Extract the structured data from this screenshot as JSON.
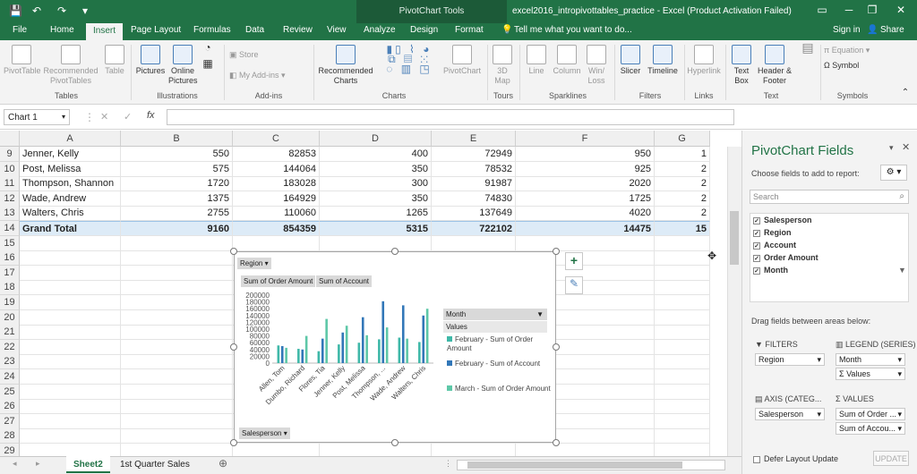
{
  "window": {
    "context_label": "PivotChart Tools",
    "title": "excel2016_intropivottables_practice - Excel (Product Activation Failed)",
    "minimize": "─",
    "restore": "❐",
    "close": "✕"
  },
  "tabs": [
    "File",
    "Home",
    "Insert",
    "Page Layout",
    "Formulas",
    "Data",
    "Review",
    "View",
    "Analyze",
    "Design",
    "Format"
  ],
  "tell_me": "Tell me what you want to do...",
  "sign_in": "Sign in",
  "share": "Share",
  "ribbon": {
    "buttons": {
      "pivottable": "PivotTable",
      "recommended_pivottables": "Recommended PivotTables",
      "table": "Table",
      "pictures": "Pictures",
      "online_pictures": "Online Pictures",
      "store": "Store",
      "my_addins": "My Add-ins",
      "recommended_charts": "Recommended Charts",
      "pivotchart": "PivotChart",
      "map3d": "3D Map",
      "line": "Line",
      "column": "Column",
      "winloss": "Win/ Loss",
      "slicer": "Slicer",
      "timeline": "Timeline",
      "hyperlink": "Hyperlink",
      "textbox": "Text Box",
      "header_footer": "Header & Footer",
      "equation": "Equation",
      "symbol": "Symbol"
    },
    "groups": {
      "tables": "Tables",
      "illustrations": "Illustrations",
      "addins": "Add-ins",
      "charts": "Charts",
      "tours": "Tours",
      "sparklines": "Sparklines",
      "filters": "Filters",
      "links": "Links",
      "text": "Text",
      "symbols": "Symbols"
    }
  },
  "formula_bar": {
    "name_box": "Chart 1",
    "fx": "fx",
    "cancel": "✕",
    "enter": "✓"
  },
  "sheet": {
    "columns": [
      "A",
      "B",
      "C",
      "D",
      "E",
      "F",
      "G"
    ],
    "rows": [
      {
        "num": "9",
        "cells": [
          "Jenner, Kelly",
          "550",
          "82853",
          "400",
          "72949",
          "950",
          "1"
        ]
      },
      {
        "num": "10",
        "cells": [
          "Post, Melissa",
          "575",
          "144064",
          "350",
          "78532",
          "925",
          "2"
        ]
      },
      {
        "num": "11",
        "cells": [
          "Thompson, Shannon",
          "1720",
          "183028",
          "300",
          "91987",
          "2020",
          "2"
        ]
      },
      {
        "num": "12",
        "cells": [
          "Wade, Andrew",
          "1375",
          "164929",
          "350",
          "74830",
          "1725",
          "2"
        ]
      },
      {
        "num": "13",
        "cells": [
          "Walters, Chris",
          "2755",
          "110060",
          "1265",
          "137649",
          "4020",
          "2"
        ]
      },
      {
        "num": "14",
        "cells": [
          "Grand Total",
          "9160",
          "854359",
          "5315",
          "722102",
          "14475",
          "15"
        ]
      },
      {
        "num": "15",
        "cells": [
          "",
          "",
          "",
          "",
          "",
          "",
          ""
        ]
      },
      {
        "num": "16",
        "cells": [
          "",
          "",
          "",
          "",
          "",
          "",
          ""
        ]
      },
      {
        "num": "17",
        "cells": [
          "",
          "",
          "",
          "",
          "",
          "",
          ""
        ]
      },
      {
        "num": "18",
        "cells": [
          "",
          "",
          "",
          "",
          "",
          "",
          ""
        ]
      },
      {
        "num": "19",
        "cells": [
          "",
          "",
          "",
          "",
          "",
          "",
          ""
        ]
      },
      {
        "num": "20",
        "cells": [
          "",
          "",
          "",
          "",
          "",
          "",
          ""
        ]
      },
      {
        "num": "21",
        "cells": [
          "",
          "",
          "",
          "",
          "",
          "",
          ""
        ]
      },
      {
        "num": "22",
        "cells": [
          "",
          "",
          "",
          "",
          "",
          "",
          ""
        ]
      },
      {
        "num": "23",
        "cells": [
          "",
          "",
          "",
          "",
          "",
          "",
          ""
        ]
      },
      {
        "num": "24",
        "cells": [
          "",
          "",
          "",
          "",
          "",
          "",
          ""
        ]
      },
      {
        "num": "25",
        "cells": [
          "",
          "",
          "",
          "",
          "",
          "",
          ""
        ]
      },
      {
        "num": "26",
        "cells": [
          "",
          "",
          "",
          "",
          "",
          "",
          ""
        ]
      },
      {
        "num": "27",
        "cells": [
          "",
          "",
          "",
          "",
          "",
          "",
          ""
        ]
      },
      {
        "num": "28",
        "cells": [
          "",
          "",
          "",
          "",
          "",
          "",
          ""
        ]
      },
      {
        "num": "29",
        "cells": [
          "",
          "",
          "",
          "",
          "",
          "",
          ""
        ]
      }
    ]
  },
  "chart_buttons": {
    "region": "Region",
    "sum_order_amount": "Sum of Order Amount",
    "sum_account": "Sum of Account",
    "month": "Month",
    "values": "Values",
    "salesperson": "Salesperson"
  },
  "chart_data": {
    "type": "bar",
    "categories": [
      "Allen, Tom",
      "Dumbo, Richard",
      "Flores, Tia",
      "Jenner, Kelly",
      "Post, Melissa",
      "Thompson, ...",
      "Wade, Andrew",
      "Walters, Chris"
    ],
    "series": [
      {
        "name": "February - Sum of Order Amount",
        "color": "#3fb8a8",
        "values": [
          52000,
          42000,
          35000,
          55000,
          60000,
          70000,
          75000,
          62000
        ]
      },
      {
        "name": "February - Sum of Account",
        "color": "#3277b8",
        "values": [
          50000,
          40000,
          72000,
          90000,
          135000,
          182000,
          170000,
          140000
        ]
      },
      {
        "name": "March - Sum of Order Amount",
        "color": "#5ec8a8",
        "values": [
          45000,
          80000,
          130000,
          110000,
          82000,
          105000,
          72000,
          160000
        ]
      }
    ],
    "yticks": [
      "200000",
      "180000",
      "160000",
      "140000",
      "120000",
      "100000",
      "80000",
      "60000",
      "40000",
      "20000",
      "0"
    ],
    "ylim": [
      0,
      200000
    ]
  },
  "panel": {
    "title": "PivotChart Fields",
    "choose_label": "Choose fields to add to report:",
    "search_placeholder": "Search",
    "fields": [
      "Salesperson",
      "Region",
      "Account",
      "Order Amount",
      "Month"
    ],
    "drag_label": "Drag fields between areas below:",
    "filters_title": "FILTERS",
    "legend_title": "LEGEND (SERIES)",
    "axis_title": "AXIS (CATEG...",
    "values_title": "VALUES",
    "filters_items": [
      "Region"
    ],
    "legend_items": [
      "Month",
      "Σ Values"
    ],
    "axis_items": [
      "Salesperson"
    ],
    "values_items": [
      "Sum of Order ...",
      "Sum of Accou..."
    ],
    "defer_label": "Defer Layout Update",
    "update_label": "UPDATE"
  },
  "sheet_tabs": [
    "Sheet2",
    "1st Quarter Sales"
  ]
}
